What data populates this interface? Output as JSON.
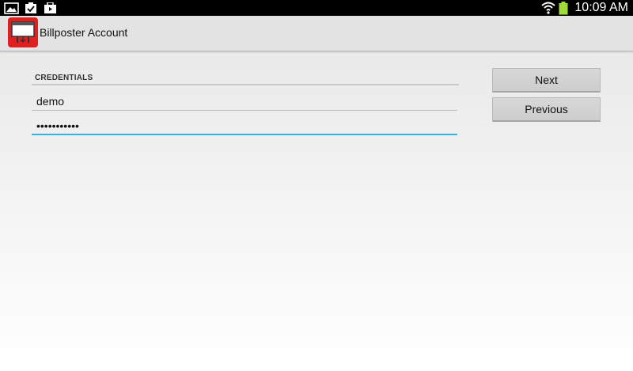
{
  "status_bar": {
    "time": "10:09 AM",
    "notification_icons": [
      "gallery-icon",
      "clipboard-check-icon",
      "briefcase-play-icon"
    ],
    "system_icons": [
      "wifi-icon",
      "battery-icon"
    ]
  },
  "action_bar": {
    "app_title": "Billposter Account",
    "app_icon": "billboard-icon",
    "app_icon_color": "#e02020"
  },
  "form": {
    "section_header": "CREDENTIALS",
    "username_value": "demo",
    "password_value": "•••••••••••",
    "focus_color": "#33b5e5"
  },
  "buttons": {
    "next_label": "Next",
    "previous_label": "Previous"
  }
}
